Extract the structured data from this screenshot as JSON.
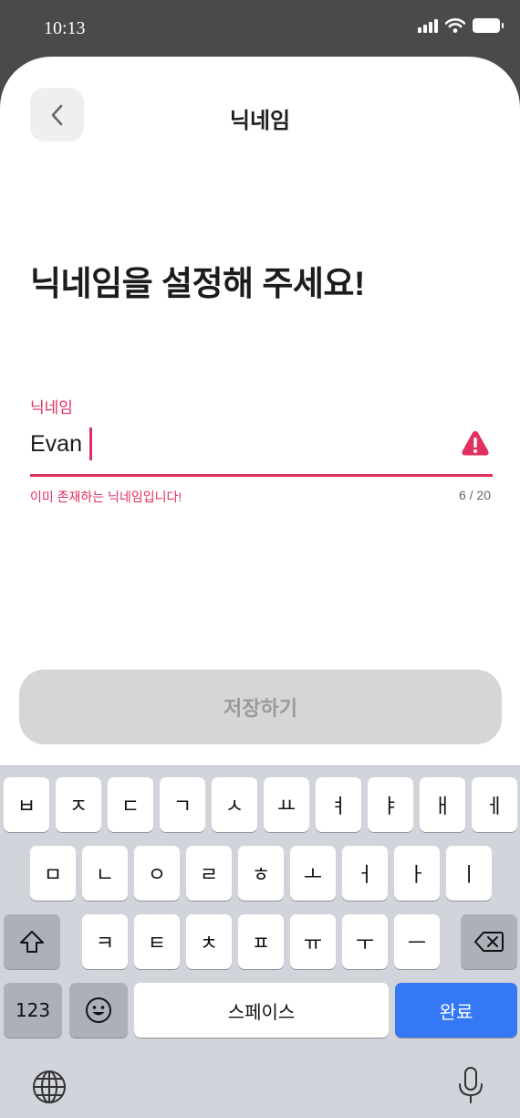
{
  "status_bar": {
    "time": "10:13"
  },
  "nav": {
    "title": "닉네임",
    "back_icon": "chevron-left-icon"
  },
  "headline": "닉네임을 설정해 주세요!",
  "nickname_field": {
    "label": "닉네임",
    "value": "Evan",
    "error": "이미 존재하는 닉네임입니다!",
    "counter": "6 / 20",
    "status_icon": "warning-icon",
    "accent_color": "#e0305f"
  },
  "save_button": {
    "label": "저장하기",
    "enabled": false
  },
  "keyboard": {
    "row1": [
      "ㅂ",
      "ㅈ",
      "ㄷ",
      "ㄱ",
      "ㅅ",
      "ㅛ",
      "ㅕ",
      "ㅑ",
      "ㅐ",
      "ㅔ"
    ],
    "row2": [
      "ㅁ",
      "ㄴ",
      "ㅇ",
      "ㄹ",
      "ㅎ",
      "ㅗ",
      "ㅓ",
      "ㅏ",
      "ㅣ"
    ],
    "row3": [
      "ㅋ",
      "ㅌ",
      "ㅊ",
      "ㅍ",
      "ㅠ",
      "ㅜ",
      "ㅡ"
    ],
    "numbers_label": "123",
    "space_label": "스페이스",
    "done_label": "완료",
    "done_color": "#3478f6"
  }
}
